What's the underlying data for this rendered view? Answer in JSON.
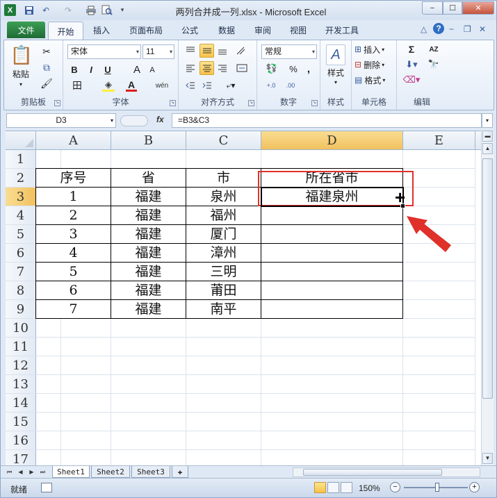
{
  "window": {
    "title": "两列合并成一列.xlsx - Microsoft Excel",
    "min": "−",
    "max": "☐",
    "close": "✕"
  },
  "quick_access": {
    "app_icon": "X",
    "save_icon": "💾",
    "undo_icon": "↶",
    "redo_icon": "↷",
    "print_icon": "⎙",
    "preview_icon": "🔍",
    "more": "▾"
  },
  "ribbon_tabs": {
    "file": "文件",
    "items": [
      "开始",
      "插入",
      "页面布局",
      "公式",
      "数据",
      "审阅",
      "视图",
      "开发工具"
    ],
    "help": "?",
    "collapse": "△"
  },
  "ribbon": {
    "clipboard": {
      "label": "剪贴板",
      "paste": "粘贴",
      "paste_icon": "📋",
      "cut": "✂",
      "copy": "⧉",
      "painter": "🖌"
    },
    "font": {
      "label": "字体",
      "name": "宋体",
      "size": "11",
      "bold": "B",
      "italic": "I",
      "underline": "U",
      "grow": "A",
      "shrink": "A",
      "border": "田",
      "fill": "◈",
      "color": "A",
      "wen": "wén"
    },
    "align": {
      "label": "对齐方式"
    },
    "number": {
      "label": "数字",
      "format": "常规",
      "percent": "%",
      "comma": ",",
      "inc": "+.0",
      "dec": ".00"
    },
    "style": {
      "label": "样式",
      "btn": "样式"
    },
    "cells": {
      "label": "单元格",
      "insert": "插入",
      "delete": "删除",
      "format": "格式"
    },
    "edit": {
      "label": "编辑",
      "sum": "Σ",
      "sort": "AZ"
    }
  },
  "formula_bar": {
    "name_box": "D3",
    "fx": "fx",
    "formula": "=B3&C3"
  },
  "sheet": {
    "columns": [
      "A",
      "B",
      "C",
      "D",
      "E"
    ],
    "rows": [
      "1",
      "2",
      "3",
      "4",
      "5",
      "6",
      "7",
      "8",
      "9",
      "10",
      "11",
      "12",
      "13",
      "14",
      "15",
      "16",
      "17"
    ],
    "header": {
      "a": "序号",
      "b": "省",
      "c": "市",
      "d": "所在省市"
    },
    "data": [
      {
        "a": "1",
        "b": "福建",
        "c": "泉州",
        "d": "福建泉州"
      },
      {
        "a": "2",
        "b": "福建",
        "c": "福州",
        "d": ""
      },
      {
        "a": "3",
        "b": "福建",
        "c": "厦门",
        "d": ""
      },
      {
        "a": "4",
        "b": "福建",
        "c": "漳州",
        "d": ""
      },
      {
        "a": "5",
        "b": "福建",
        "c": "三明",
        "d": ""
      },
      {
        "a": "6",
        "b": "福建",
        "c": "莆田",
        "d": ""
      },
      {
        "a": "7",
        "b": "福建",
        "c": "南平",
        "d": ""
      }
    ],
    "cursor": "+"
  },
  "sheet_tabs": [
    "Sheet1",
    "Sheet2",
    "Sheet3"
  ],
  "status": {
    "ready": "就绪",
    "zoom": "150%",
    "zoom_out": "−",
    "zoom_in": "+"
  },
  "colors": {
    "highlight": "#e0302a",
    "active_header": "#f1c15f"
  }
}
